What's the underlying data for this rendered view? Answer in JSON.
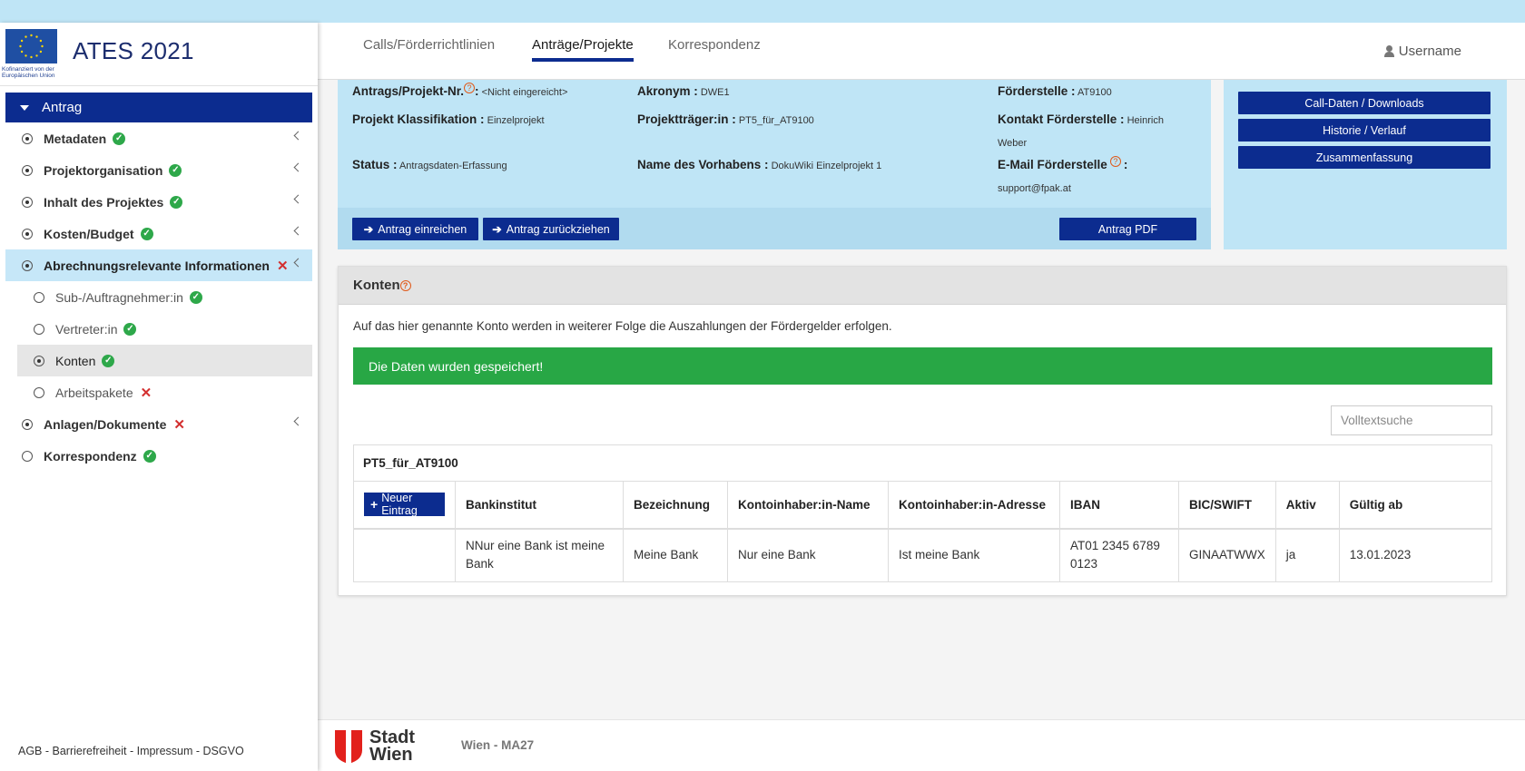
{
  "sidebar": {
    "eu_text": "Kofinanziert von der Europäischen Union",
    "app_title": "ATES 2021",
    "section": "Antrag",
    "items": [
      {
        "label": "Metadaten",
        "status": "ok"
      },
      {
        "label": "Projektorganisation",
        "status": "ok"
      },
      {
        "label": "Inhalt des Projektes",
        "status": "ok"
      },
      {
        "label": "Kosten/Budget",
        "status": "ok"
      },
      {
        "label": "Abrechnungsrelevante Informationen",
        "status": "error"
      },
      {
        "label": "Sub-/Auftragnehmer:in",
        "status": "ok"
      },
      {
        "label": "Vertreter:in",
        "status": "ok"
      },
      {
        "label": "Konten",
        "status": "ok"
      },
      {
        "label": "Arbeitspakete",
        "status": "error"
      },
      {
        "label": "Anlagen/Dokumente",
        "status": "error"
      },
      {
        "label": "Korrespondenz",
        "status": "ok"
      }
    ],
    "footer_links": "AGB - Barrierefreiheit - Impressum - DSGVO"
  },
  "header": {
    "tabs": [
      "Calls/Förderrichtlinien",
      "Anträge/Projekte",
      "Korrespondenz"
    ],
    "active_tab": "Anträge/Projekte",
    "username": "Username"
  },
  "info": {
    "antrag_nr_label": "Antrags/Projekt-Nr.",
    "antrag_nr_value": "<Nicht eingereicht>",
    "akronym_label": "Akronym :",
    "akronym_value": "DWE1",
    "foerderstelle_label": "Förderstelle :",
    "foerderstelle_value": "AT9100",
    "klassifikation_label": "Projekt Klassifikation :",
    "klassifikation_value": "Einzelprojekt",
    "traeger_label": "Projektträger:in :",
    "traeger_value": "PT5_für_AT9100",
    "kontakt_label": "Kontakt Förderstelle :",
    "kontakt_value_1": "Heinrich",
    "kontakt_value_2": "Weber",
    "status_label": "Status :",
    "status_value": "Antragsdaten-Erfassung",
    "vorhaben_label": "Name des Vorhabens :",
    "vorhaben_value": "DokuWiki Einzelprojekt 1",
    "email_label": "E-Mail Förderstelle",
    "email_value": "support@fpak.at",
    "colon": ":",
    "help_glyph": "?",
    "btn_einreichen": "Antrag einreichen",
    "btn_zurueckziehen": "Antrag zurückziehen",
    "btn_pdf": "Antrag PDF"
  },
  "side_panel": {
    "buttons": [
      "Call-Daten / Downloads",
      "Historie / Verlauf",
      "Zusammenfassung"
    ]
  },
  "konten": {
    "title": "Konten",
    "description": "Auf das hier genannte Konto werden in weiterer Folge die Auszahlungen der Fördergelder erfolgen.",
    "alert": "Die Daten wurden gespeichert!",
    "search_placeholder": "Volltextsuche",
    "group": "PT5_für_AT9100",
    "new_entry": "Neuer Eintrag",
    "columns": [
      "Bankinstitut",
      "Bezeichnung",
      "Kontoinhaber:in-Name",
      "Kontoinhaber:in-Adresse",
      "IBAN",
      "BIC/SWIFT",
      "Aktiv",
      "Gültig ab"
    ],
    "rows": [
      [
        "NNur eine Bank ist meine Bank",
        "Meine Bank",
        "Nur eine Bank",
        "Ist meine Bank",
        "AT01 2345 6789 0123",
        "GINAATWWX",
        "ja",
        "13.01.2023"
      ]
    ]
  },
  "footer": {
    "logo_line1": "Stadt",
    "logo_line2": "Wien",
    "org": "Wien - MA27"
  },
  "colors": {
    "primary": "#0c2c8f",
    "panel": "#bfe5f6",
    "success": "#28a745",
    "error": "#d32f2f"
  }
}
